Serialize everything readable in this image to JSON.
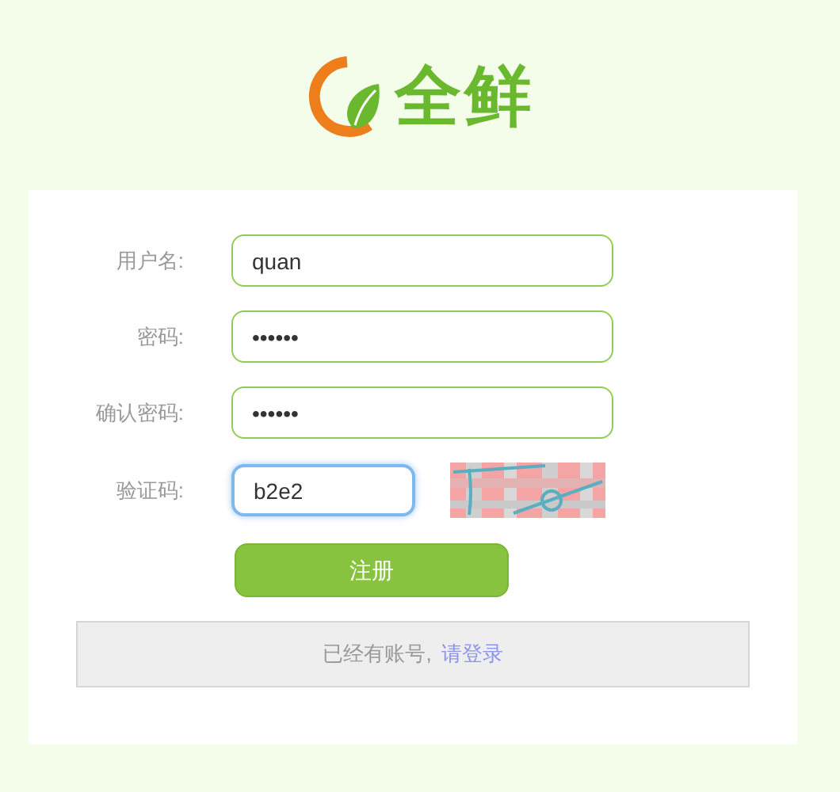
{
  "logo": {
    "text": "全鲜"
  },
  "form": {
    "fields": [
      {
        "label": "用户名:",
        "value": "quan",
        "focused": false,
        "kind": "text"
      },
      {
        "label": "密码:",
        "value": "••••••",
        "focused": false,
        "kind": "text"
      },
      {
        "label": "确认密码:",
        "value": "••••••",
        "focused": false,
        "kind": "text"
      },
      {
        "label": "验证码:",
        "value": "b2e2",
        "focused": true,
        "kind": "captcha"
      }
    ],
    "submit_button": "注册"
  },
  "login_prompt": {
    "text": "已经有账号,",
    "link": "请登录"
  }
}
